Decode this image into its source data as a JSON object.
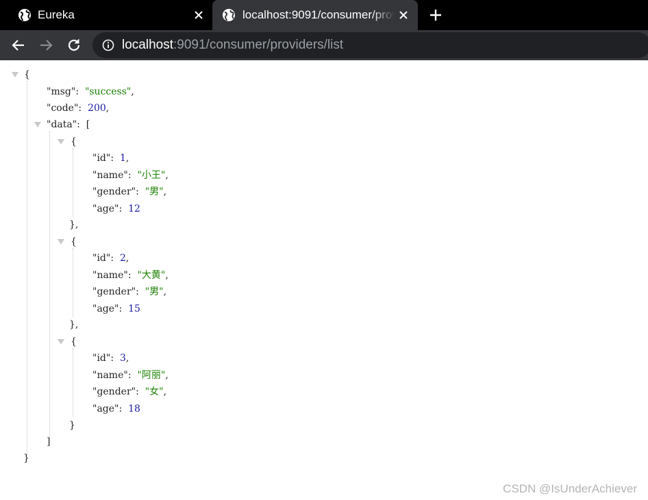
{
  "browser": {
    "tabs": [
      {
        "title": "Eureka"
      },
      {
        "title": "localhost:9091/consumer/providers/list"
      }
    ],
    "address_bar": {
      "host": "localhost",
      "rest": ":9091/consumer/providers/list"
    }
  },
  "json_view": {
    "root_open": "{",
    "root_close": "}",
    "msg_key": "\"msg\"",
    "msg_value": "\"success\"",
    "code_key": "\"code\"",
    "code_value": "200",
    "data_key": "\"data\"",
    "data_open": "[",
    "data_close": "]",
    "items": [
      {
        "id": "1",
        "name": "\"小王\"",
        "gender": "\"男\"",
        "age": "12"
      },
      {
        "id": "2",
        "name": "\"大黄\"",
        "gender": "\"男\"",
        "age": "15"
      },
      {
        "id": "3",
        "name": "\"阿丽\"",
        "gender": "\"女\"",
        "age": "18"
      }
    ],
    "keys": {
      "id": "\"id\"",
      "name": "\"name\"",
      "gender": "\"gender\"",
      "age": "\"age\""
    }
  },
  "watermark": "CSDN @IsUnderAchiever"
}
